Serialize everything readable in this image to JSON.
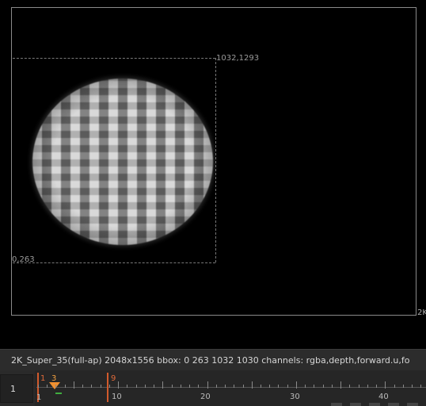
{
  "viewer": {
    "format_corner_label": "2K",
    "bbox_top_right_label": "1032,1293",
    "bbox_bottom_left_label": "0,263"
  },
  "info_bar": {
    "text": "2K_Super_35(full-ap) 2048x1556  bbox: 0 263 1032 1030 channels: rgba,depth,forward.u,fo"
  },
  "timeline": {
    "current_frame_field": "1",
    "in_point_label": "1",
    "current_frame_label": "3",
    "out_point_label": "9",
    "start_label": "1",
    "ruler_numbers": [
      "10",
      "20",
      "30",
      "40"
    ]
  },
  "colors": {
    "in_out_markers": "#d25a2c",
    "current_frame_handle": "#f09030",
    "keyframe_marker": "#3fae3f"
  }
}
